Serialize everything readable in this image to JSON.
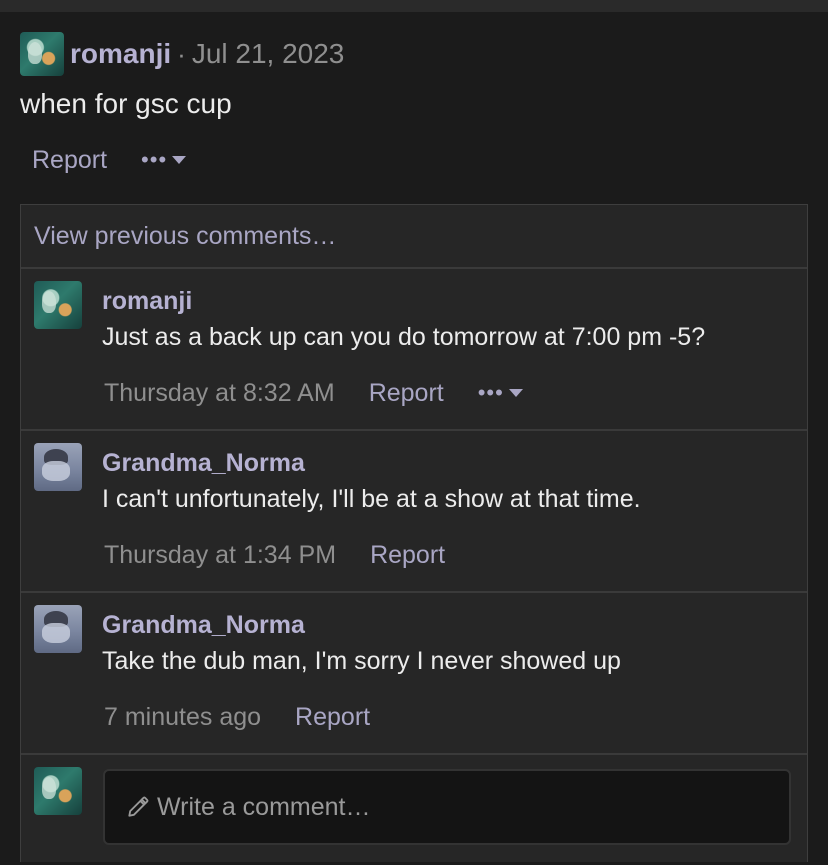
{
  "post": {
    "author": "romanji",
    "separator": "·",
    "date": "Jul 21, 2023",
    "body": "when for gsc cup",
    "report_label": "Report",
    "more_label": "•••"
  },
  "comments_panel": {
    "view_previous_label": "View previous comments…",
    "comments": [
      {
        "author": "romanji",
        "text": "Just as a back up can you do tomorrow at 7:00 pm -5?",
        "time": "Thursday at 8:32 AM",
        "report_label": "Report",
        "more_label": "•••"
      },
      {
        "author": "Grandma_Norma",
        "text": "I can't unfortunately, I'll be at a show at that time.",
        "time": "Thursday at 1:34 PM",
        "report_label": "Report"
      },
      {
        "author": "Grandma_Norma",
        "text": "Take the dub man, I'm sorry I never showed up",
        "time": "7 minutes ago",
        "report_label": "Report"
      }
    ],
    "reply": {
      "placeholder": "Write a comment…",
      "icon": "pencil-icon"
    }
  },
  "colors": {
    "background": "#1b1b1b",
    "panel": "#262626",
    "username": "#b6b2d2",
    "link": "#a9a6c4",
    "muted": "#8f8f8f"
  }
}
